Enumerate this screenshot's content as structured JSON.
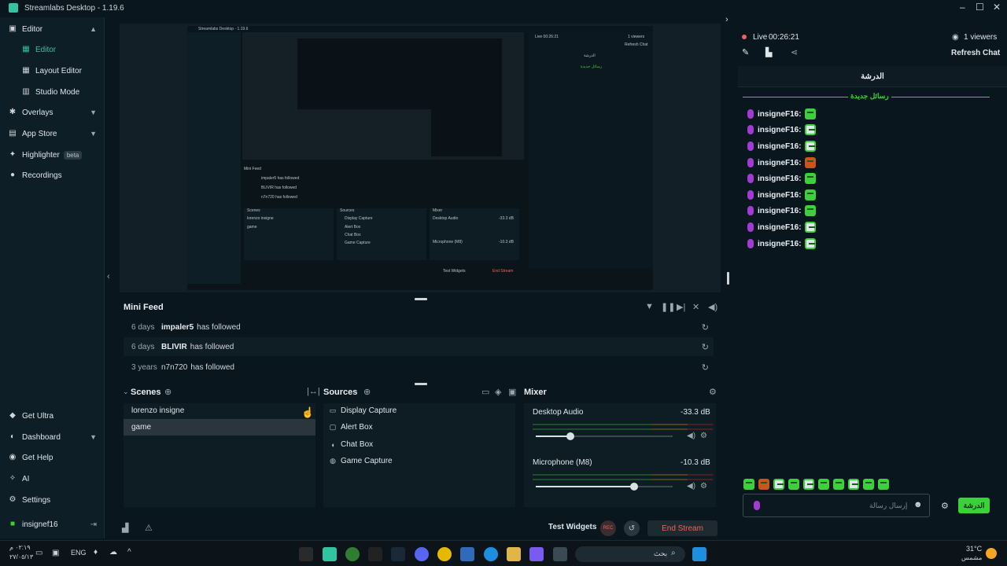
{
  "app": {
    "title": "Streamlabs Desktop - 1.19.6"
  },
  "window_controls": {
    "minimize": "–",
    "maximize": "☐",
    "close": "✕"
  },
  "sidebar": {
    "items": [
      {
        "label": "Editor",
        "icon": "editor-icon",
        "expanded": true
      },
      {
        "label": "Editor",
        "icon": "layout-icon",
        "sub": true,
        "active": true
      },
      {
        "label": "Layout Editor",
        "icon": "grid-icon",
        "sub": true
      },
      {
        "label": "Studio Mode",
        "icon": "studio-icon",
        "sub": true
      },
      {
        "label": "Overlays",
        "icon": "overlays-icon"
      },
      {
        "label": "App Store",
        "icon": "store-icon"
      },
      {
        "label": "Highlighter",
        "icon": "highlighter-icon",
        "badge": "beta"
      },
      {
        "label": "Recordings",
        "icon": "recordings-icon"
      }
    ],
    "bottom": [
      {
        "label": "Get Ultra",
        "icon": "ultra-icon"
      },
      {
        "label": "Dashboard",
        "icon": "dashboard-icon"
      },
      {
        "label": "Get Help",
        "icon": "help-icon"
      },
      {
        "label": "AI",
        "icon": "ai-icon"
      },
      {
        "label": "Settings",
        "icon": "settings-icon"
      },
      {
        "label": "insignef16",
        "icon": "user-icon"
      }
    ]
  },
  "mini_feed": {
    "title": "Mini Feed",
    "rows": [
      {
        "ago": "6 days",
        "name": "impaler5",
        "action": "has followed"
      },
      {
        "ago": "6 days",
        "name": "BLIVIR",
        "action": "has followed"
      },
      {
        "ago": "3 years",
        "name": "n7n720",
        "action": "has followed"
      }
    ]
  },
  "scenes": {
    "title": "Scenes",
    "items": [
      "lorenzo insigne",
      "game"
    ]
  },
  "sources": {
    "title": "Sources",
    "items": [
      {
        "label": "Display Capture",
        "icon": "monitor-icon"
      },
      {
        "label": "Alert Box",
        "icon": "alert-icon"
      },
      {
        "label": "Chat Box",
        "icon": "chat-icon"
      },
      {
        "label": "Game Capture",
        "icon": "gamepad-icon"
      }
    ]
  },
  "mixer": {
    "title": "Mixer",
    "channels": [
      {
        "label": "Desktop Audio",
        "db": "-33.3 dB",
        "level": 0.25
      },
      {
        "label": "Microphone (M8)",
        "db": "-10.3 dB",
        "level": 0.72
      }
    ]
  },
  "footer": {
    "test_widgets": "Test Widgets",
    "rec": "REC",
    "end_stream": "End Stream"
  },
  "chat": {
    "live": "Live",
    "time": "00:26:21",
    "viewers": "1 viewers",
    "refresh": "Refresh Chat",
    "title": "الدرشة",
    "new_messages": "رسائل جديدة",
    "messages": [
      {
        "user": "insigneF16:",
        "emote": "green"
      },
      {
        "user": "insigneF16:",
        "emote": "white"
      },
      {
        "user": "insigneF16:",
        "emote": "white"
      },
      {
        "user": "insigneF16:",
        "emote": "red"
      },
      {
        "user": "insigneF16:",
        "emote": "green"
      },
      {
        "user": "insigneF16:",
        "emote": "green"
      },
      {
        "user": "insigneF16:",
        "emote": "green"
      },
      {
        "user": "insigneF16:",
        "emote": "white"
      },
      {
        "user": "insigneF16:",
        "emote": "white"
      }
    ],
    "input_placeholder": "إرسال رسالة",
    "send_label": "الدرشة"
  },
  "taskbar": {
    "time": "٠٢:١٩ م",
    "date": "٢٧/٠٥/١٣",
    "lang": "ENG",
    "search_placeholder": "بحث",
    "weather_temp": "31°C",
    "weather_desc": "مشمس"
  },
  "preview_mini": {
    "title": "Streamlabs Desktop - 1.19.6",
    "mini_feed": "Mini Feed",
    "feed_rows": [
      "impaler5  has followed",
      "BLIVIR  has followed",
      "n7n720  has followed"
    ],
    "scenes": "Scenes",
    "sources": "Sources",
    "mixer": "Mixer",
    "scene_items": [
      "lorenzo insigne",
      "game"
    ],
    "source_items": [
      "Display Capture",
      "Alert Box",
      "Chat Box",
      "Game Capture"
    ],
    "mixer_items": [
      "Desktop Audio",
      "Microphone (M8)"
    ],
    "mixer_db": [
      "-33.3 dB",
      "-10.3 dB"
    ],
    "chat_title": "الدرشة",
    "chat_new": "رسائل جديدة",
    "live": "Live 00:26:21",
    "viewers": "1 viewers",
    "refresh": "Refresh Chat",
    "test_widgets": "Test Widgets",
    "end_stream": "End Stream"
  }
}
